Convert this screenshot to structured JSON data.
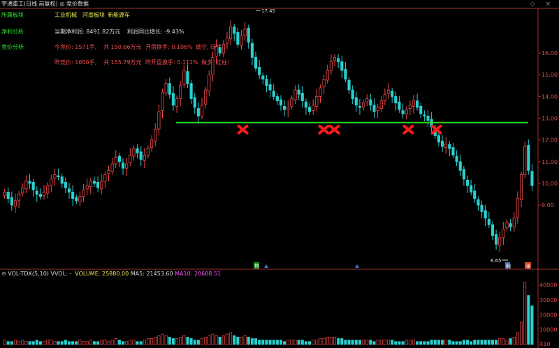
{
  "window": {
    "title": "宇通重工(日线 前复权)",
    "tab_label": "竞价数据",
    "controls": "◇ ×"
  },
  "sidebar": {
    "sector_label": "所属板块",
    "profit_label": "净利分析",
    "auction_label": "竞价分析"
  },
  "sectors": [
    "工业机械",
    "河南板块",
    "新能源车"
  ],
  "profit": {
    "net_profit_text": "当期净利润: 8491.82万元",
    "growth_text": "利润同比增长: -9.43%"
  },
  "auction": {
    "today_volume": "今竞价: 1571手,",
    "today_amount": "共 150.66万元",
    "today_turnover": "开盘换手: 0.106%",
    "today_trend": "做空, 绿柱!",
    "yest_volume": "昨竞价: 1650手,",
    "yest_amount": "共 155.79万元",
    "yest_turnover": "昨开盘换手: 0.111%",
    "yest_trend": "做多, 红柱!"
  },
  "price_axis": {
    "ticks": [
      "16.00",
      "15.00",
      "14.00",
      "13.00",
      "12.00",
      "11.00",
      "10.00",
      "9.00"
    ],
    "high_label": "17.45",
    "low_label": "6.65"
  },
  "markers": {
    "left_badge": "热",
    "right_badge": "利",
    "right_badge2": "涨"
  },
  "volume_panel": {
    "indicator": "VOL-TDX(5,10)",
    "vvol": "VVOL: -",
    "volume": "VOLUME: 25880.00",
    "ma5": "MA5: 21453.60",
    "ma10": "MA10: 20608.51",
    "ticks": [
      "40000",
      "30000",
      "20000",
      "10000"
    ],
    "unit": "X10"
  },
  "colors": {
    "up": "#f04a4a",
    "down": "#2ad0d0",
    "support_line": "#22dd22",
    "cross": "#ff1a1a"
  },
  "chart_data": {
    "type": "candlestick",
    "support_level": 12.8,
    "high": 17.45,
    "low": 6.65,
    "ylim": [
      6.5,
      17.8
    ],
    "closes": [
      9.6,
      9.3,
      9.0,
      9.2,
      9.5,
      9.8,
      10.1,
      10.0,
      9.7,
      9.5,
      9.4,
      9.6,
      9.9,
      10.2,
      10.4,
      10.3,
      10.0,
      9.8,
      9.6,
      9.3,
      9.2,
      9.4,
      9.7,
      9.9,
      10.1,
      10.0,
      9.8,
      10.1,
      10.4,
      10.6,
      10.9,
      11.2,
      11.0,
      10.7,
      10.9,
      11.3,
      11.6,
      11.4,
      11.1,
      11.3,
      11.6,
      12.0,
      12.5,
      13.3,
      14.2,
      14.6,
      14.1,
      13.6,
      13.9,
      14.5,
      15.2,
      14.6,
      13.9,
      13.5,
      13.1,
      13.6,
      14.3,
      15.0,
      15.8,
      16.3,
      16.0,
      16.4,
      16.7,
      17.2,
      16.9,
      16.4,
      16.8,
      17.1,
      16.5,
      15.8,
      15.3,
      15.0,
      14.8,
      14.5,
      14.3,
      14.0,
      13.8,
      13.6,
      13.4,
      13.5,
      13.9,
      14.3,
      14.1,
      13.8,
      13.5,
      13.3,
      13.6,
      14.0,
      14.4,
      14.8,
      15.2,
      15.6,
      15.8,
      15.6,
      15.2,
      14.8,
      14.3,
      13.9,
      13.6,
      13.5,
      13.7,
      13.9,
      13.6,
      13.3,
      13.5,
      13.8,
      14.1,
      14.3,
      14.0,
      13.7,
      13.4,
      13.2,
      13.4,
      13.6,
      13.8,
      13.5,
      13.2,
      13.1,
      12.9,
      12.6,
      12.2,
      11.9,
      11.7,
      11.8,
      11.6,
      11.3,
      11.0,
      10.6,
      10.2,
      9.9,
      9.6,
      9.3,
      9.0,
      8.7,
      8.4,
      8.1,
      7.6,
      7.2,
      7.5,
      7.9,
      8.2,
      8.0,
      8.4,
      9.3,
      10.4,
      11.7,
      10.6,
      9.9
    ],
    "volumes": [
      3,
      2,
      2,
      3,
      2,
      3,
      2,
      2,
      2,
      3,
      2,
      2,
      3,
      3,
      2,
      2,
      2,
      3,
      2,
      2,
      2,
      3,
      2,
      2,
      3,
      2,
      2,
      3,
      3,
      2,
      3,
      4,
      3,
      2,
      2,
      3,
      3,
      2,
      2,
      3,
      4,
      4,
      5,
      6,
      7,
      6,
      5,
      4,
      4,
      5,
      6,
      5,
      4,
      3,
      3,
      4,
      5,
      6,
      7,
      6,
      5,
      6,
      7,
      8,
      6,
      5,
      5,
      6,
      5,
      4,
      4,
      3,
      3,
      3,
      3,
      3,
      3,
      3,
      2,
      3,
      3,
      3,
      3,
      3,
      2,
      2,
      3,
      3,
      4,
      4,
      5,
      5,
      5,
      4,
      4,
      3,
      3,
      3,
      3,
      3,
      3,
      3,
      3,
      2,
      3,
      3,
      3,
      3,
      3,
      2,
      2,
      2,
      3,
      3,
      3,
      2,
      2,
      2,
      2,
      3,
      3,
      3,
      3,
      3,
      3,
      2,
      2,
      2,
      3,
      3,
      2,
      3,
      3,
      3,
      3,
      3,
      3,
      3,
      4,
      4,
      3,
      4,
      5,
      8,
      15,
      42,
      33,
      26
    ],
    "cross_positions": [
      0.12,
      0.35,
      0.38,
      0.59,
      0.67
    ]
  }
}
